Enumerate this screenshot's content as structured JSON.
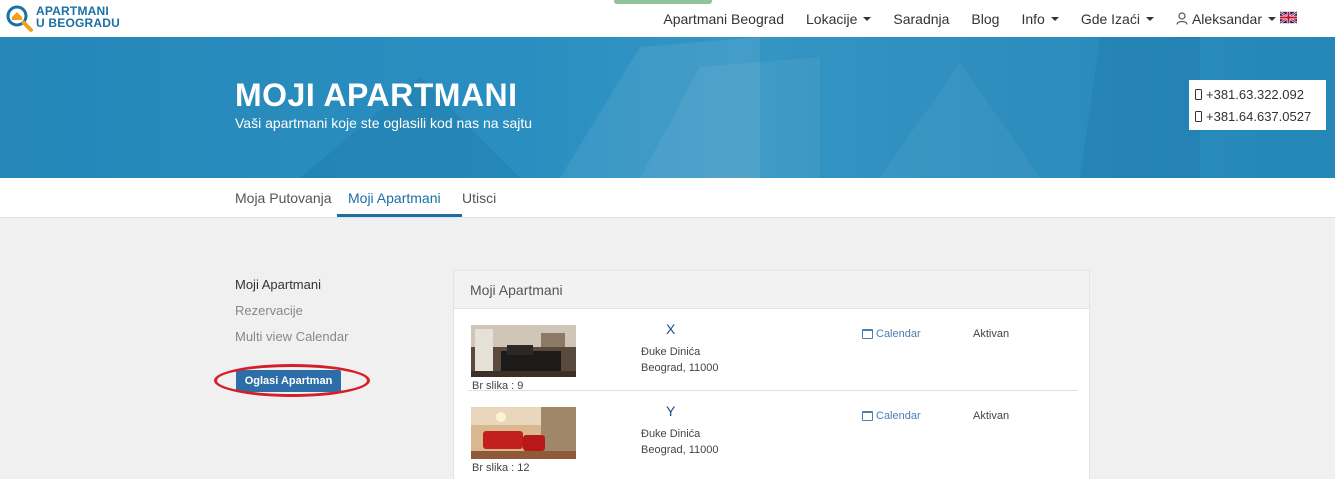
{
  "logo": {
    "line1": "APARTMANI",
    "line2": "U BEOGRADU",
    "icon": "magnifier-house-icon"
  },
  "nav": {
    "items": [
      {
        "label": "Apartmani Beograd",
        "caret": false
      },
      {
        "label": "Lokacije",
        "caret": true
      },
      {
        "label": "Saradnja",
        "caret": false
      },
      {
        "label": "Blog",
        "caret": false
      },
      {
        "label": "Info",
        "caret": true
      },
      {
        "label": "Gde Izaći",
        "caret": true
      },
      {
        "label": "Aleksandar",
        "caret": true,
        "icon": "user-icon"
      }
    ],
    "language_icon": "uk-flag-icon"
  },
  "hero": {
    "title": "MOJI APARTMANI",
    "subtitle": "Vaši apartmani koje ste oglasili kod nas na sajtu",
    "phones": [
      "+381.63.322.092",
      "+381.64.637.0527"
    ]
  },
  "tabs": [
    {
      "label": "Moja Putovanja",
      "active": false
    },
    {
      "label": "Moji Apartmani",
      "active": true
    },
    {
      "label": "Utisci",
      "active": false
    }
  ],
  "sidebar": {
    "items": [
      {
        "label": "Moji Apartmani",
        "active": true
      },
      {
        "label": "Rezervacije",
        "active": false
      },
      {
        "label": "Multi view Calendar",
        "active": false
      }
    ],
    "cta_label": "Oglasi Apartman"
  },
  "panel": {
    "title": "Moji Apartmani",
    "apartments": [
      {
        "name": "X",
        "street": "Đuke Dinića",
        "city": "Beograd, 11000",
        "photos": "Br slika : 9",
        "calendar": "Calendar",
        "status": "Aktivan"
      },
      {
        "name": "Y",
        "street": "Đuke Dinića",
        "city": "Beograd, 11000",
        "photos": "Br slika : 12",
        "calendar": "Calendar",
        "status": "Aktivan"
      }
    ]
  },
  "colors": {
    "brand": "#1a6fa5",
    "hero": "#2a8fc0",
    "button": "#2d6ea8",
    "highlight": "#d41f2a"
  }
}
